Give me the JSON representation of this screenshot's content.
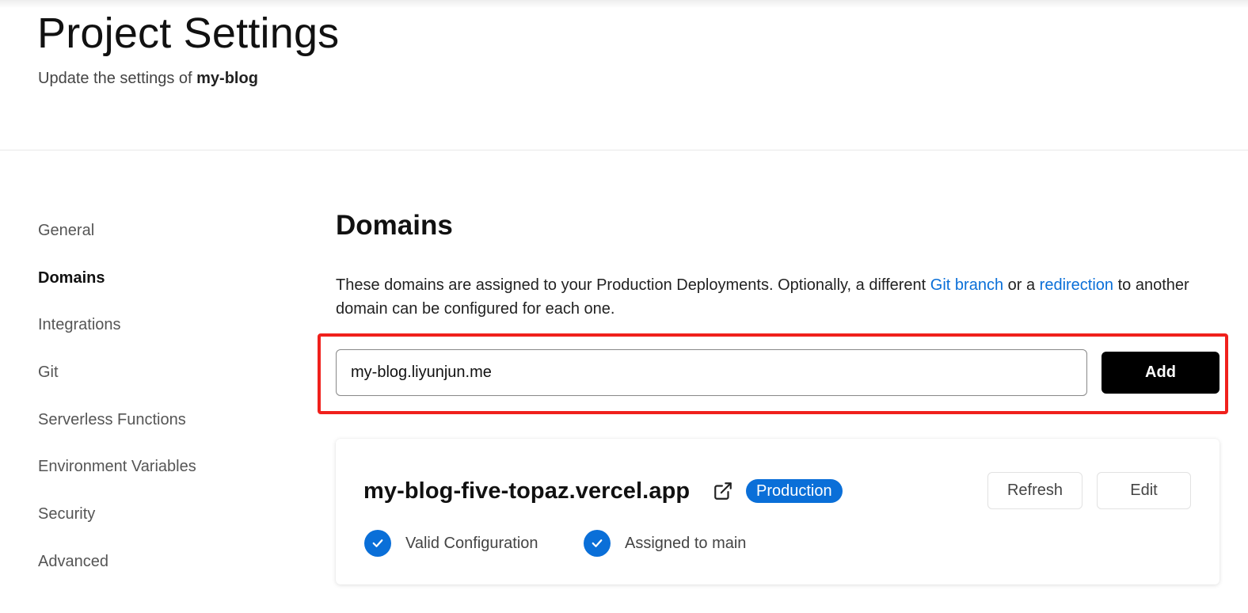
{
  "header": {
    "title": "Project Settings",
    "subtitle_prefix": "Update the settings of",
    "project_name": "my-blog"
  },
  "sidebar": {
    "items": [
      {
        "label": "General",
        "active": false
      },
      {
        "label": "Domains",
        "active": true
      },
      {
        "label": "Integrations",
        "active": false
      },
      {
        "label": "Git",
        "active": false
      },
      {
        "label": "Serverless Functions",
        "active": false
      },
      {
        "label": "Environment Variables",
        "active": false
      },
      {
        "label": "Security",
        "active": false
      },
      {
        "label": "Advanced",
        "active": false
      }
    ]
  },
  "domains": {
    "title": "Domains",
    "description_part1": "These domains are assigned to your Production Deployments. Optionally, a different",
    "link_git_branch": "Git branch",
    "description_part2": "or a",
    "link_redirection": "redirection",
    "description_part3": "to another domain can be configured for each one.",
    "input_value": "my-blog.liyunjun.me",
    "add_label": "Add",
    "card": {
      "domain": "my-blog-five-topaz.vercel.app",
      "badge": "Production",
      "refresh_label": "Refresh",
      "edit_label": "Edit",
      "statuses": [
        {
          "label": "Valid Configuration",
          "icon": "check-circle-icon"
        },
        {
          "label": "Assigned to main",
          "icon": "check-circle-icon"
        }
      ]
    }
  },
  "colors": {
    "accent": "#0a6fd8",
    "highlight": "#f0201c",
    "button_dark": "#000000"
  }
}
